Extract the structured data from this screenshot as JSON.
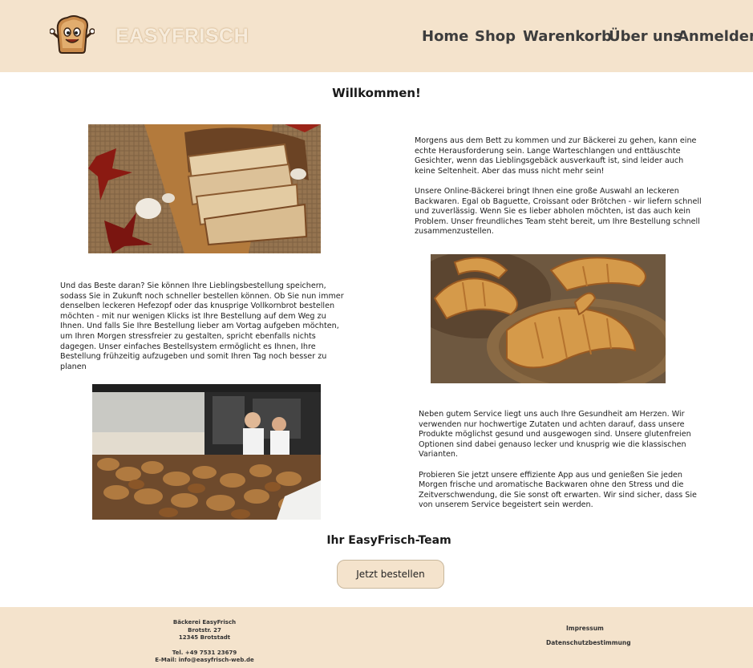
{
  "header": {
    "brand": "EASYFRISCH",
    "nav": [
      "Home",
      "Shop",
      "Warenkorb",
      "Über uns",
      "Anmelden"
    ]
  },
  "main": {
    "title": "Willkommen!",
    "paragraphs": [
      "Morgens aus dem Bett zu kommen und zur Bäckerei zu gehen, kann eine echte Herausforderung sein. Lange Warteschlangen und enttäuschte Gesichter, wenn das Lieblingsgebäck ausverkauft ist, sind leider auch keine Seltenheit. Aber das muss nicht mehr sein!",
      "Unsere Online-Bäckerei bringt Ihnen eine große Auswahl an leckeren Backwaren. Egal ob Baguette, Croissant oder Brötchen - wir liefern schnell und zuverlässig. Wenn Sie es lieber abholen möchten, ist das auch kein Problem. Unser freundliches Team steht bereit, um Ihre Bestellung schnell zusammenzustellen.",
      "Und das Beste daran? Sie können Ihre Lieblingsbestellung speichern, sodass Sie in Zukunft noch schneller bestellen können. Ob Sie nun immer denselben leckeren Hefezopf oder das knusprige Vollkornbrot bestellen möchten - mit nur wenigen Klicks ist Ihre Bestellung auf dem Weg zu Ihnen. Und falls Sie Ihre Bestellung lieber am Vortag aufgeben möchten, um Ihren Morgen stressfreier zu gestalten, spricht ebenfalls nichts dagegen. Unser einfaches Bestellsystem ermöglicht es Ihnen, Ihre Bestellung frühzeitig aufzugeben und somit Ihren Tag noch besser zu planen",
      "Neben gutem Service liegt uns auch Ihre Gesundheit am Herzen. Wir verwenden nur hochwertige Zutaten und achten darauf, dass unsere Produkte möglichst gesund und ausgewogen sind. Unsere glutenfreien Optionen sind dabei genauso lecker und knusprig wie die klassischen Varianten.",
      "Probieren Sie jetzt unsere effiziente App aus und genießen Sie jeden Morgen frische und aromatische Backwaren ohne den Stress und die Zeitverschwendung, die Sie sonst oft erwarten. Wir sind sicher, dass Sie von unserem Service begeistert sein werden."
    ],
    "signoff": "Ihr EasyFrisch-Team",
    "order_button": "Jetzt bestellen"
  },
  "footer": {
    "company": "Bäckerei EasyFrisch",
    "street": "Brotstr. 27",
    "city": "12345 Brotstadt",
    "phone": "Tel. +49 7531 23679",
    "email": "E-Mail: info@easyfrisch-web.de",
    "impressum": "Impressum",
    "datenschutz": "Datenschutzbestimmung"
  },
  "colors": {
    "header_bg": "#f4e3cc",
    "footer_bg": "#f4e3cc",
    "button_bg": "#f4e3cc"
  }
}
